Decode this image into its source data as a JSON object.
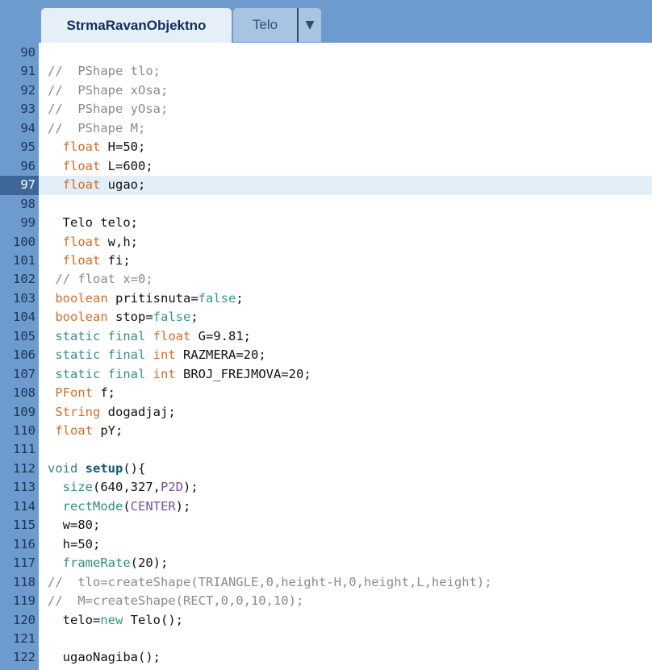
{
  "tabs": [
    {
      "label": "StrmaRavanObjektno",
      "active": true
    },
    {
      "label": "Telo",
      "active": false
    }
  ],
  "tab_menu_glyph": "▼",
  "current_line": 97,
  "lines": [
    {
      "num": "90",
      "tokens": []
    },
    {
      "num": "91",
      "tokens": [
        {
          "t": "//  PShape tlo;",
          "c": "c-comment"
        }
      ]
    },
    {
      "num": "92",
      "tokens": [
        {
          "t": "//  PShape xOsa;",
          "c": "c-comment"
        }
      ]
    },
    {
      "num": "93",
      "tokens": [
        {
          "t": "//  PShape yOsa;",
          "c": "c-comment"
        }
      ]
    },
    {
      "num": "94",
      "tokens": [
        {
          "t": "//  PShape M;",
          "c": "c-comment"
        }
      ]
    },
    {
      "num": "95",
      "tokens": [
        {
          "t": "  ",
          "c": ""
        },
        {
          "t": "float",
          "c": "c-kw"
        },
        {
          "t": " H=50;",
          "c": ""
        }
      ]
    },
    {
      "num": "96",
      "tokens": [
        {
          "t": "  ",
          "c": ""
        },
        {
          "t": "float",
          "c": "c-kw"
        },
        {
          "t": " L=600;",
          "c": ""
        }
      ]
    },
    {
      "num": "97",
      "tokens": [
        {
          "t": "  ",
          "c": ""
        },
        {
          "t": "float",
          "c": "c-kw"
        },
        {
          "t": " ugao;",
          "c": ""
        }
      ]
    },
    {
      "num": "98",
      "tokens": []
    },
    {
      "num": "99",
      "tokens": [
        {
          "t": "  Telo telo;",
          "c": ""
        }
      ]
    },
    {
      "num": "100",
      "tokens": [
        {
          "t": "  ",
          "c": ""
        },
        {
          "t": "float",
          "c": "c-kw"
        },
        {
          "t": " w,h;",
          "c": ""
        }
      ]
    },
    {
      "num": "101",
      "tokens": [
        {
          "t": "  ",
          "c": ""
        },
        {
          "t": "float",
          "c": "c-kw"
        },
        {
          "t": " fi;",
          "c": ""
        }
      ]
    },
    {
      "num": "102",
      "tokens": [
        {
          "t": " // float x=0;",
          "c": "c-comment"
        }
      ]
    },
    {
      "num": "103",
      "tokens": [
        {
          "t": " ",
          "c": ""
        },
        {
          "t": "boolean",
          "c": "c-kw"
        },
        {
          "t": " pritisnuta=",
          "c": ""
        },
        {
          "t": "false",
          "c": "c-lit"
        },
        {
          "t": ";",
          "c": ""
        }
      ]
    },
    {
      "num": "104",
      "tokens": [
        {
          "t": " ",
          "c": ""
        },
        {
          "t": "boolean",
          "c": "c-kw"
        },
        {
          "t": " stop=",
          "c": ""
        },
        {
          "t": "false",
          "c": "c-lit"
        },
        {
          "t": ";",
          "c": ""
        }
      ]
    },
    {
      "num": "105",
      "tokens": [
        {
          "t": " ",
          "c": ""
        },
        {
          "t": "static final",
          "c": "c-kw2"
        },
        {
          "t": " ",
          "c": ""
        },
        {
          "t": "float",
          "c": "c-kw"
        },
        {
          "t": " G=9.81;",
          "c": ""
        }
      ]
    },
    {
      "num": "106",
      "tokens": [
        {
          "t": " ",
          "c": ""
        },
        {
          "t": "static final",
          "c": "c-kw2"
        },
        {
          "t": " ",
          "c": ""
        },
        {
          "t": "int",
          "c": "c-kw"
        },
        {
          "t": " RAZMERA=20;",
          "c": ""
        }
      ]
    },
    {
      "num": "107",
      "tokens": [
        {
          "t": " ",
          "c": ""
        },
        {
          "t": "static final",
          "c": "c-kw2"
        },
        {
          "t": " ",
          "c": ""
        },
        {
          "t": "int",
          "c": "c-kw"
        },
        {
          "t": " BROJ_FREJMOVA=20;",
          "c": ""
        }
      ]
    },
    {
      "num": "108",
      "tokens": [
        {
          "t": " ",
          "c": ""
        },
        {
          "t": "PFont",
          "c": "c-kw"
        },
        {
          "t": " f;",
          "c": ""
        }
      ]
    },
    {
      "num": "109",
      "tokens": [
        {
          "t": " ",
          "c": ""
        },
        {
          "t": "String",
          "c": "c-kw"
        },
        {
          "t": " dogadjaj;",
          "c": ""
        }
      ]
    },
    {
      "num": "110",
      "tokens": [
        {
          "t": " ",
          "c": ""
        },
        {
          "t": "float",
          "c": "c-kw"
        },
        {
          "t": " pY;",
          "c": ""
        }
      ]
    },
    {
      "num": "111",
      "tokens": []
    },
    {
      "num": "112",
      "tokens": [
        {
          "t": "void",
          "c": "c-void"
        },
        {
          "t": " ",
          "c": ""
        },
        {
          "t": "setup",
          "c": "c-bold"
        },
        {
          "t": "(){",
          "c": ""
        }
      ]
    },
    {
      "num": "113",
      "tokens": [
        {
          "t": "  ",
          "c": ""
        },
        {
          "t": "size",
          "c": "c-fn"
        },
        {
          "t": "(640,327,",
          "c": ""
        },
        {
          "t": "P2D",
          "c": "c-const"
        },
        {
          "t": ");",
          "c": ""
        }
      ]
    },
    {
      "num": "114",
      "tokens": [
        {
          "t": "  ",
          "c": ""
        },
        {
          "t": "rectMode",
          "c": "c-fn"
        },
        {
          "t": "(",
          "c": ""
        },
        {
          "t": "CENTER",
          "c": "c-const"
        },
        {
          "t": ");",
          "c": ""
        }
      ]
    },
    {
      "num": "115",
      "tokens": [
        {
          "t": "  w=80;",
          "c": ""
        }
      ]
    },
    {
      "num": "116",
      "tokens": [
        {
          "t": "  h=50;",
          "c": ""
        }
      ]
    },
    {
      "num": "117",
      "tokens": [
        {
          "t": "  ",
          "c": ""
        },
        {
          "t": "frameRate",
          "c": "c-fn"
        },
        {
          "t": "(20);",
          "c": ""
        }
      ]
    },
    {
      "num": "118",
      "tokens": [
        {
          "t": "//  tlo=createShape(TRIANGLE,0,height-H,0,height,L,height);",
          "c": "c-comment"
        }
      ]
    },
    {
      "num": "119",
      "tokens": [
        {
          "t": "//  M=createShape(RECT,0,0,10,10);",
          "c": "c-comment"
        }
      ]
    },
    {
      "num": "120",
      "tokens": [
        {
          "t": "  telo=",
          "c": ""
        },
        {
          "t": "new",
          "c": "c-lit"
        },
        {
          "t": " Telo();",
          "c": ""
        }
      ]
    },
    {
      "num": "121",
      "tokens": []
    },
    {
      "num": "122",
      "tokens": [
        {
          "t": "  ugaoNagiba();",
          "c": ""
        }
      ]
    }
  ]
}
